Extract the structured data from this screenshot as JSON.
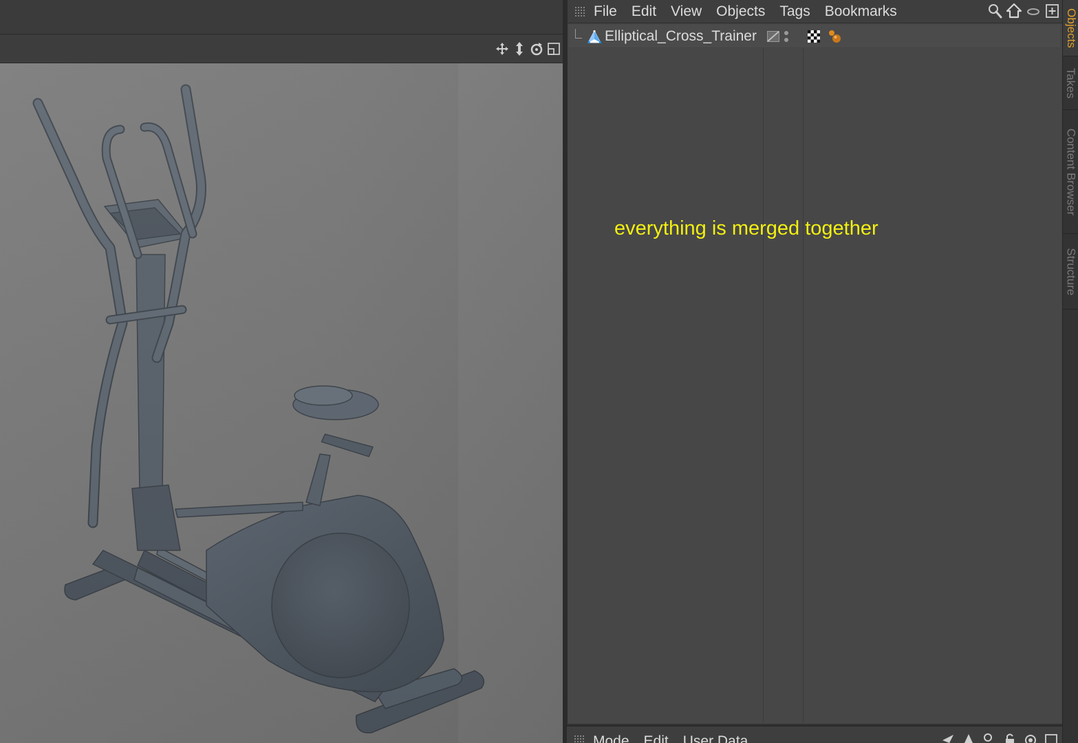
{
  "object_manager": {
    "menu": [
      {
        "label": "File"
      },
      {
        "label": "Edit"
      },
      {
        "label": "View"
      },
      {
        "label": "Objects"
      },
      {
        "label": "Tags"
      },
      {
        "label": "Bookmarks"
      }
    ],
    "objects": [
      {
        "name": "Elliptical_Cross_Trainer",
        "icon": "polygon-object-icon",
        "tags": [
          "checker-material-tag-icon",
          "material-tag-icon"
        ]
      }
    ],
    "note": "everything is merged together",
    "tools": [
      "search-icon",
      "home-icon",
      "link-icon",
      "new-window-icon"
    ]
  },
  "side_tabs": [
    {
      "label": "Objects",
      "active": true
    },
    {
      "label": "Takes",
      "active": false
    },
    {
      "label": "Content Browser",
      "active": false
    },
    {
      "label": "Structure",
      "active": false
    }
  ],
  "attribute_manager": {
    "menu": [
      {
        "label": "Mode"
      },
      {
        "label": "Edit"
      },
      {
        "label": "User Data"
      }
    ]
  },
  "viewport": {
    "nav_icons": [
      "move-view-icon",
      "dolly-view-icon",
      "rotate-view-icon",
      "maximize-view-icon"
    ],
    "model": "elliptical-cross-trainer"
  },
  "colors": {
    "note_text": "#f2ef12",
    "active_tab": "#e0a030",
    "panel_bg": "#474747",
    "viewport_bg": "#777777",
    "model_color": "#535c66"
  }
}
